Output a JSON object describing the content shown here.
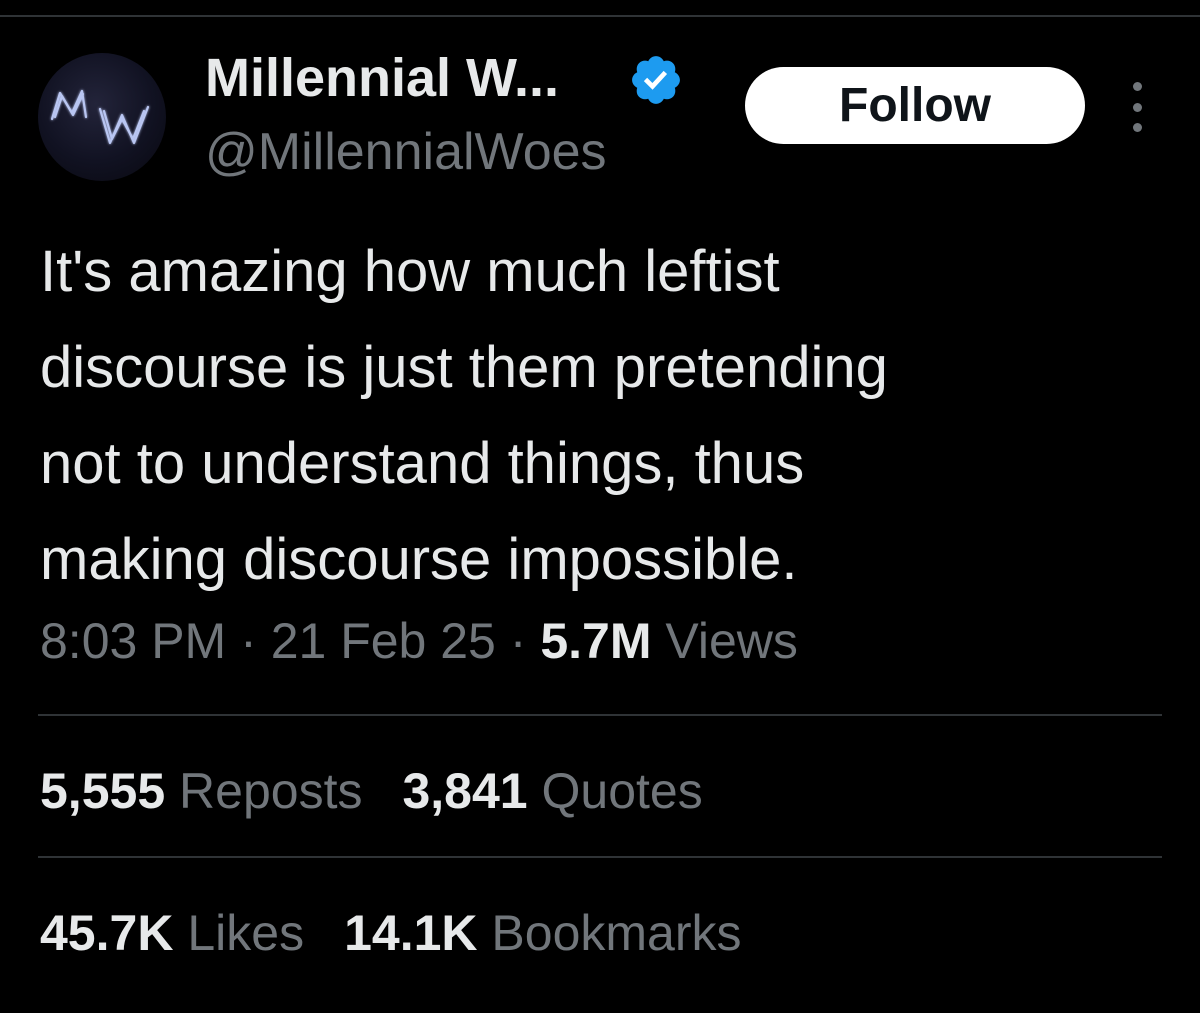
{
  "author": {
    "display_name": "Millennial W...",
    "handle": "@MillennialWoes",
    "avatar_text": "MW"
  },
  "follow_button": {
    "label": "Follow"
  },
  "more_menu": {
    "icon": "more-vertical-icon"
  },
  "tweet": {
    "lines": [
      "It's amazing how much leftist",
      "discourse is just them pretending",
      "not to understand things, thus",
      "making discourse impossible."
    ]
  },
  "meta": {
    "time": "8:03 PM",
    "separator": "·",
    "date": "21 Feb 25",
    "views_count": "5.7M",
    "views_label": "Views"
  },
  "stats": {
    "reposts_count": "5,555",
    "reposts_label": "Reposts",
    "quotes_count": "3,841",
    "quotes_label": "Quotes",
    "likes_count": "45.7K",
    "likes_label": "Likes",
    "bookmarks_count": "14.1K",
    "bookmarks_label": "Bookmarks"
  },
  "colors": {
    "background": "#000000",
    "primary_text": "#e7e9ea",
    "secondary_text": "#71767b",
    "divider": "#2f3336",
    "verified_blue": "#1d9bf0",
    "follow_bg": "#ffffff"
  }
}
